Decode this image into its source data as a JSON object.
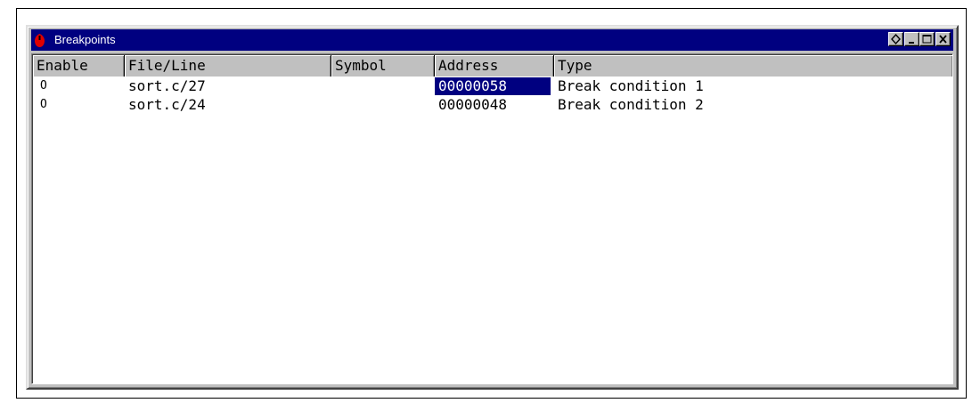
{
  "window": {
    "title": "Breakpoints",
    "controls": [
      {
        "name": "restore-diamond-button",
        "icon": "diamond-icon"
      },
      {
        "name": "minimize-button",
        "icon": "minimize-icon"
      },
      {
        "name": "maximize-button",
        "icon": "maximize-icon"
      },
      {
        "name": "close-button",
        "icon": "close-icon"
      }
    ],
    "app_icon": "breakpoint-app-icon"
  },
  "table": {
    "columns": [
      "Enable",
      "File/Line",
      "Symbol",
      "Address",
      "Type"
    ],
    "rows": [
      {
        "enable": "O",
        "file_line": "sort.c/27",
        "symbol": "",
        "address": "00000058",
        "type": "Break condition 1",
        "selected_cell": "address"
      },
      {
        "enable": "O",
        "file_line": "sort.c/24",
        "symbol": "",
        "address": "00000048",
        "type": "Break condition 2"
      }
    ]
  },
  "colors": {
    "titlebar": "#000080",
    "selection": "#000080",
    "chrome": "#c0c0c0",
    "app_icon": "#e00000"
  }
}
